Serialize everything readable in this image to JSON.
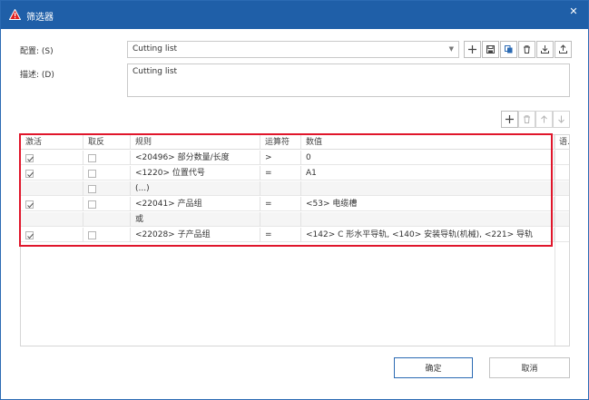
{
  "window": {
    "title": "筛选器",
    "accent": "#1f5fa8",
    "highlight_color": "#e0162b"
  },
  "form": {
    "config_label": "配置: (S)",
    "config_value": "Cutting list",
    "desc_label": "描述: (D)",
    "desc_value": "Cutting list"
  },
  "toolbar_icons": [
    "plus-icon",
    "save-icon",
    "copy-icon",
    "delete-icon",
    "import-icon",
    "export-icon"
  ],
  "grid_toolbar_icons": [
    "plus-icon",
    "delete-icon",
    "arrow-up-icon",
    "arrow-down-icon"
  ],
  "table": {
    "headers": {
      "active": "激活",
      "invert": "取反",
      "rule": "规则",
      "operator": "运算符",
      "value": "数值",
      "extra": "语."
    },
    "rows": [
      {
        "active": true,
        "invert": false,
        "rule": "<20496> 部分数量/长度",
        "operator": ">",
        "value": "0"
      },
      {
        "active": true,
        "invert": false,
        "rule": "<1220> 位置代号",
        "operator": "=",
        "value": "A1"
      },
      {
        "active": null,
        "invert": false,
        "rule": "(...)",
        "operator": "",
        "value": ""
      },
      {
        "active": true,
        "invert": false,
        "rule": "<22041> 产品组",
        "operator": "=",
        "value": "<53> 电缆槽"
      },
      {
        "active": null,
        "invert": null,
        "rule": "或",
        "operator": "",
        "value": ""
      },
      {
        "active": true,
        "invert": false,
        "rule": "<22028> 子产品组",
        "operator": "=",
        "value": "<142> C 形水平导轨, <140> 安装导轨(机械), <221> 导轨"
      }
    ]
  },
  "buttons": {
    "ok": "确定",
    "cancel": "取消"
  }
}
